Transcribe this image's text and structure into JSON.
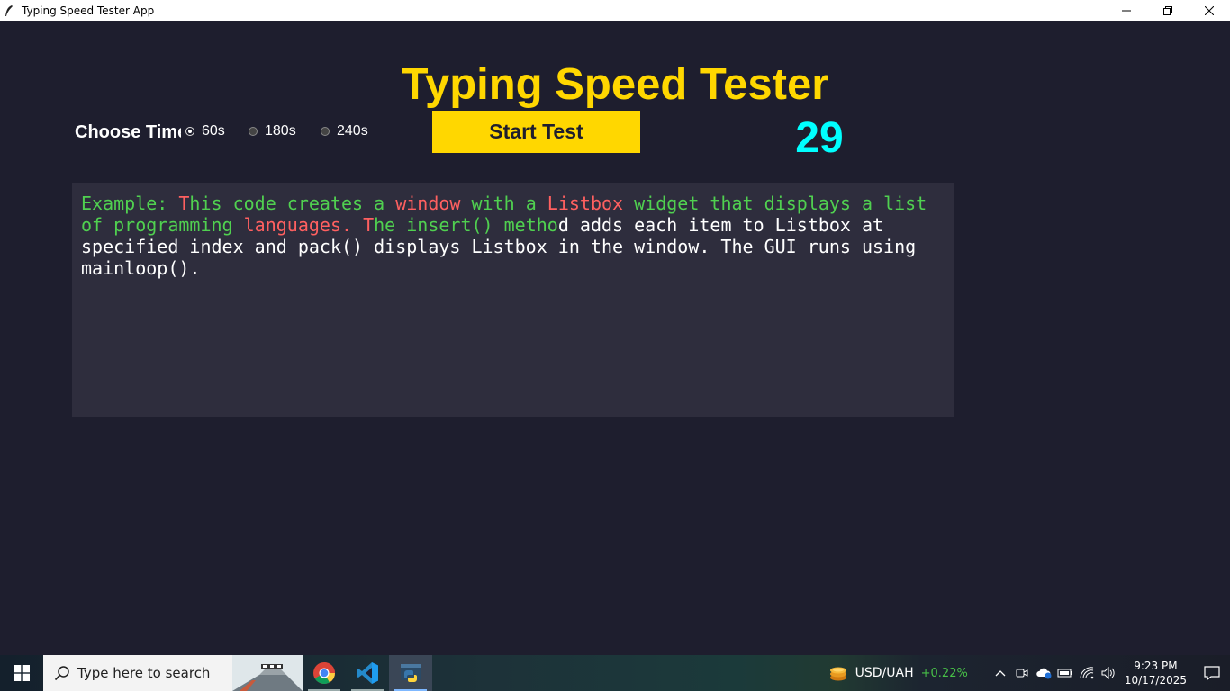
{
  "window": {
    "title": "Typing Speed Tester App",
    "controls": [
      "minimize",
      "restore",
      "close"
    ]
  },
  "app": {
    "heading": "Typing Speed Tester",
    "choose_time_label": "Choose Time",
    "time_options": [
      {
        "label": "60s",
        "selected": true
      },
      {
        "label": "180s",
        "selected": false
      },
      {
        "label": "240s",
        "selected": false
      }
    ],
    "start_button": "Start Test",
    "timer": "29",
    "colors": {
      "background": "#1e1e2e",
      "panel": "#2e2d3d",
      "accent": "#ffd700",
      "timer": "#00ffff",
      "correct": "#50d050",
      "wrong": "#ff6060"
    },
    "text_segments": [
      {
        "text": "Example: ",
        "state": "correct"
      },
      {
        "text": "T",
        "state": "wrong"
      },
      {
        "text": "his code creates a ",
        "state": "correct"
      },
      {
        "text": "window",
        "state": "wrong"
      },
      {
        "text": " with a ",
        "state": "correct"
      },
      {
        "text": "Listbox",
        "state": "wrong"
      },
      {
        "text": " widget that displays a list of programming ",
        "state": "correct"
      },
      {
        "text": "languages.",
        "state": "wrong"
      },
      {
        "text": " ",
        "state": "correct"
      },
      {
        "text": "T",
        "state": "wrong"
      },
      {
        "text": "he insert() metho",
        "state": "correct"
      },
      {
        "text": "d adds each item to Listbox at specified index and pack() displays Listbox in the window. The GUI runs using mainloop().",
        "state": "pending"
      }
    ]
  },
  "taskbar": {
    "search_placeholder": "Type here to search",
    "apps": [
      {
        "name": "chrome-icon",
        "running": true,
        "active": false
      },
      {
        "name": "vscode-icon",
        "running": true,
        "active": false
      },
      {
        "name": "python-icon",
        "running": true,
        "active": true
      }
    ],
    "ticker": {
      "name": "USD/UAH",
      "change": "+0.22%"
    },
    "time": "9:23 PM",
    "date": "10/17/2025"
  }
}
